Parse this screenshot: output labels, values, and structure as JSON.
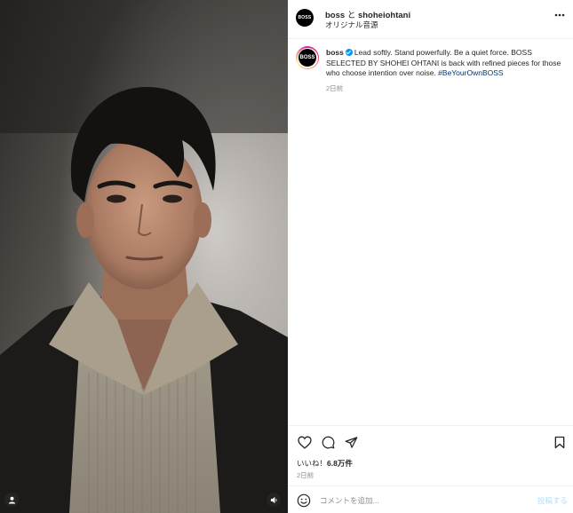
{
  "post": {
    "account": "boss",
    "title_connector": " と ",
    "collaborator": "shoheiohtani",
    "audio": "オリジナル音源",
    "avatar_text": "BOSS"
  },
  "caption": {
    "username": "boss",
    "text": "Lead softly. Stand powerfully. Be a quiet force. BOSS SELECTED BY SHOHEI OHTANI is back with refined pieces for those who choose intention over noise. ",
    "hashtag": "#BeYourOwnBOSS",
    "time": "2日前"
  },
  "actions": {
    "like_icon": "heart-icon",
    "comment_icon": "comment-icon",
    "share_icon": "paper-plane-icon",
    "save_icon": "bookmark-icon"
  },
  "likes": {
    "label": "いいね！",
    "count": "6.8万件"
  },
  "post_time": "2日前",
  "comment_box": {
    "placeholder": "コメントを追加...",
    "post_label": "投稿する"
  },
  "colors": {
    "accent_link": "#00376b",
    "verified": "#0095f6",
    "muted": "#8e8e8e",
    "post_disabled": "#b2dffc"
  }
}
